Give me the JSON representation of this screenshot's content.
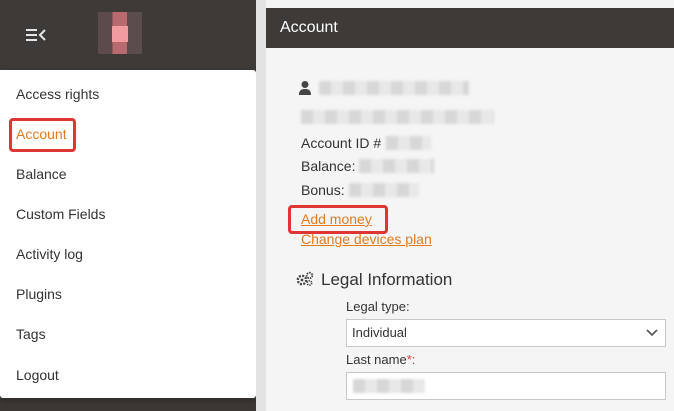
{
  "app": {
    "header_title": "Account"
  },
  "menu": {
    "items": [
      {
        "label": "Access rights",
        "active": false
      },
      {
        "label": "Account",
        "active": true
      },
      {
        "label": "Balance",
        "active": false
      },
      {
        "label": "Custom Fields",
        "active": false
      },
      {
        "label": "Activity log",
        "active": false
      },
      {
        "label": "Plugins",
        "active": false
      },
      {
        "label": "Tags",
        "active": false
      },
      {
        "label": "Logout",
        "active": false
      }
    ]
  },
  "account": {
    "id_label": "Account ID #",
    "balance_label": "Balance:",
    "bonus_label": "Bonus:",
    "add_money_link": "Add money",
    "change_plan_link": "Change devices plan"
  },
  "legal": {
    "section_title": "Legal Information",
    "legal_type_label": "Legal type:",
    "legal_type_value": "Individual",
    "last_name_label": "Last name",
    "required_mark": "*:"
  },
  "colors": {
    "accent": "#e07b22",
    "highlight": "#e03535",
    "dark_header": "#3d3a37"
  },
  "icons": {
    "hamburger": "menu-collapse-icon",
    "user": "user-icon",
    "gears": "gears-icon",
    "chevron": "chevron-down-icon"
  }
}
